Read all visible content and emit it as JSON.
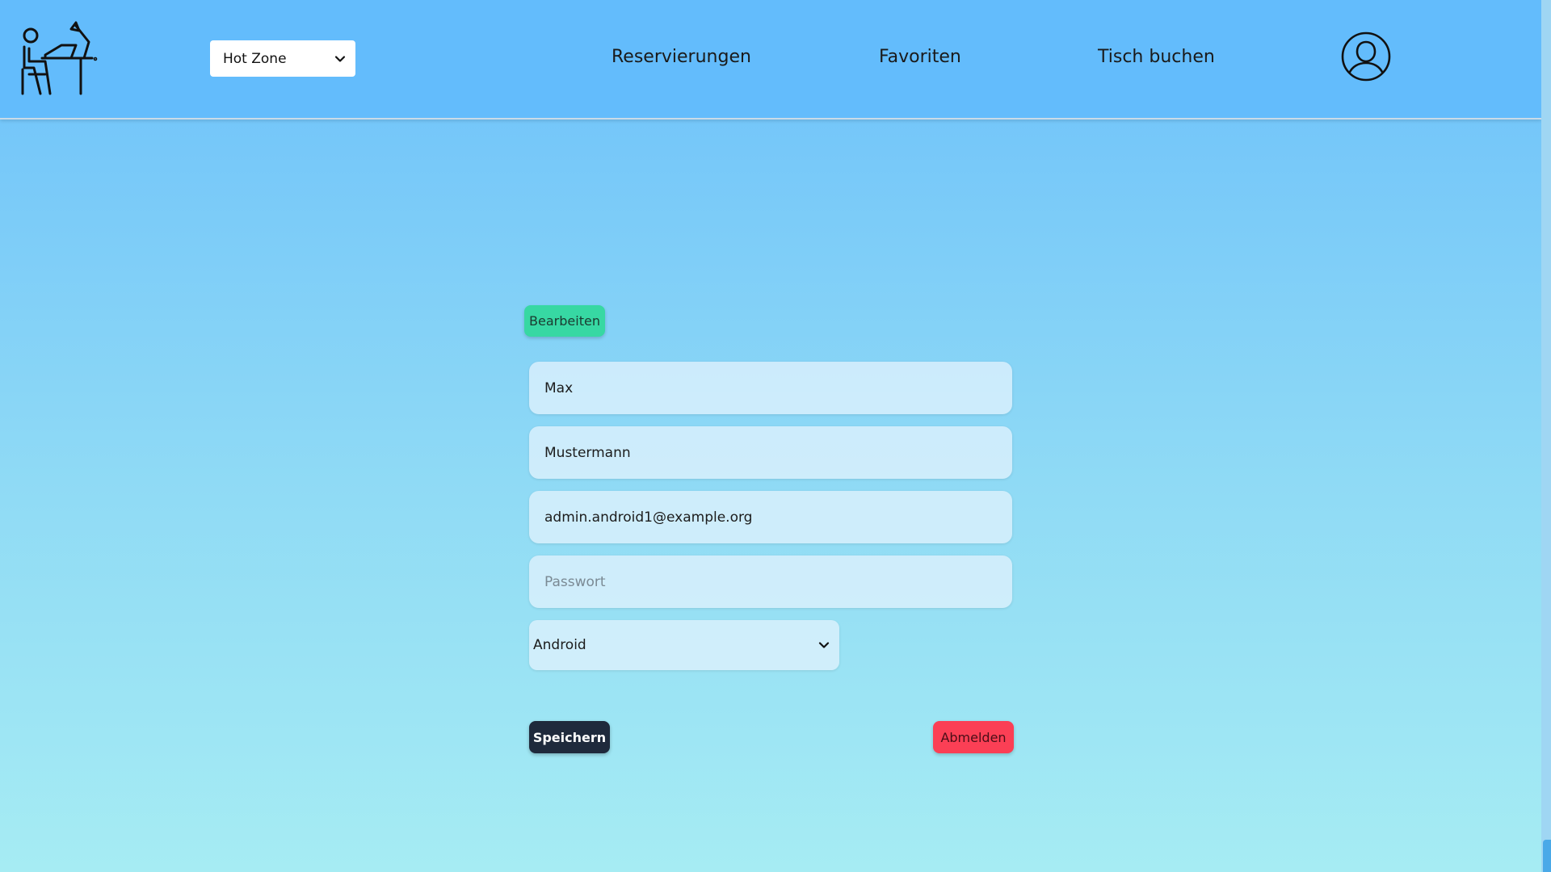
{
  "header": {
    "logo_icon": "person-at-desk-icon",
    "zone_select": {
      "value": "Hot Zone"
    },
    "nav": [
      {
        "label": "Reservierungen"
      },
      {
        "label": "Favoriten"
      },
      {
        "label": "Tisch buchen"
      }
    ],
    "profile_icon": "user-avatar-icon"
  },
  "profile": {
    "edit_label": "Bearbeiten",
    "first_name": "Max",
    "last_name": "Mustermann",
    "email": "admin.android1@example.org",
    "password_placeholder": "Passwort",
    "role_select": {
      "value": "Android"
    },
    "save_label": "Speichern",
    "logout_label": "Abmelden"
  },
  "colors": {
    "header_bg": "#63bcfc",
    "edit_button": "#37d8a3",
    "save_button": "#1f2a3c",
    "logout_button": "#fb3f55"
  }
}
